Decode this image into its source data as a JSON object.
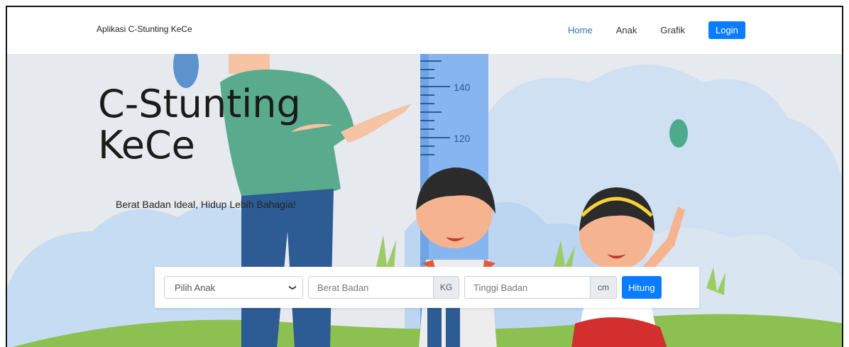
{
  "navbar": {
    "brand": "Aplikasi C-Stunting KeCe",
    "links": [
      "Home",
      "Anak",
      "Grafik"
    ],
    "active": "Home",
    "login_label": "Login"
  },
  "hero": {
    "title_line1": "C-Stunting",
    "title_line2": "KeCe",
    "subtitle": "Berat Badan Ideal, Hidup Lebih Bahagia!",
    "ruler_labels": [
      "140",
      "120"
    ]
  },
  "calculator": {
    "select_placeholder": "Pilih Anak",
    "weight_placeholder": "Berat Badan",
    "weight_unit": "KG",
    "height_placeholder": "Tinggi Badan",
    "height_unit": "cm",
    "submit_label": "Hitung"
  },
  "colors": {
    "accent": "#0a7cff",
    "active_link": "#2f75b5"
  }
}
